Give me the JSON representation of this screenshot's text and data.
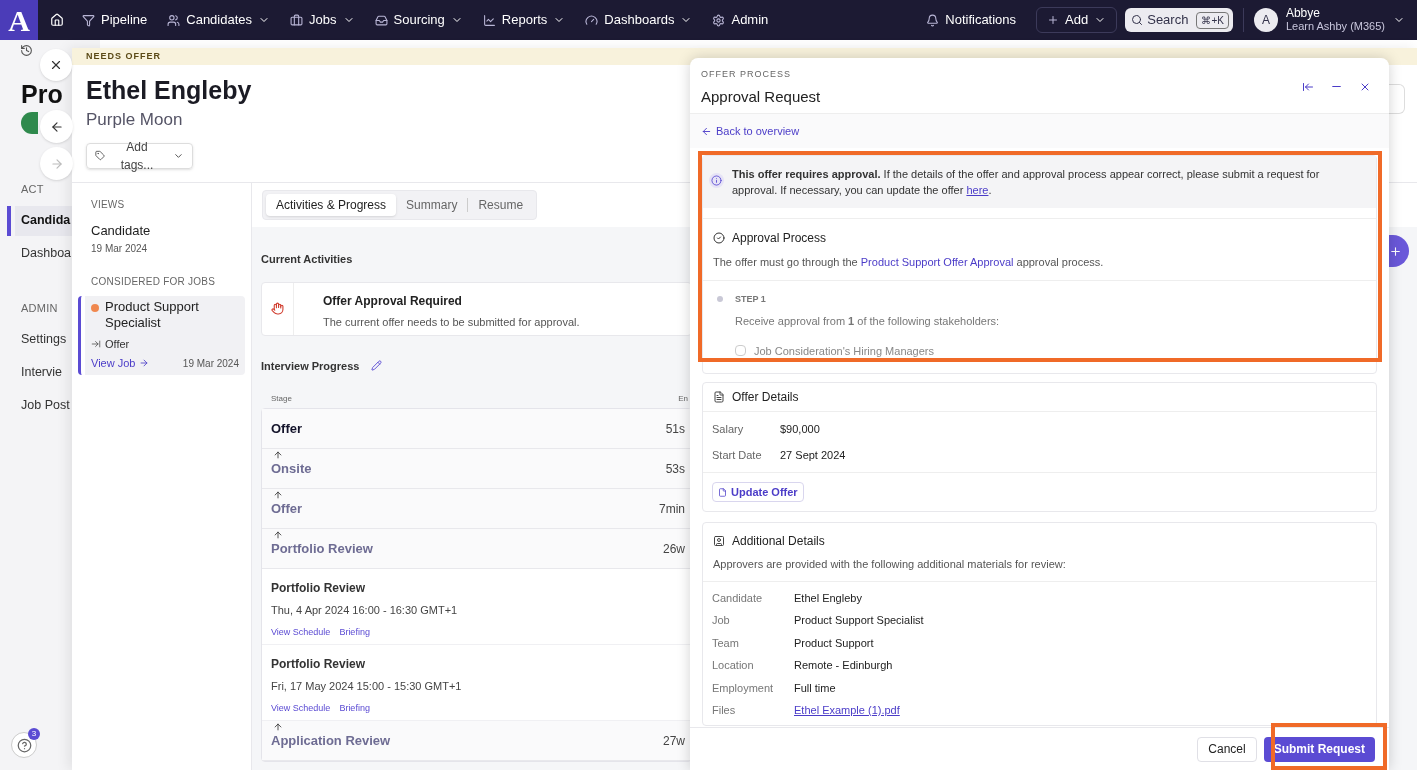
{
  "nav": {
    "logo": "A",
    "items": [
      {
        "label": "Pipeline",
        "dropdown": false
      },
      {
        "label": "Candidates",
        "dropdown": true
      },
      {
        "label": "Jobs",
        "dropdown": true
      },
      {
        "label": "Sourcing",
        "dropdown": true
      },
      {
        "label": "Reports",
        "dropdown": true
      },
      {
        "label": "Dashboards",
        "dropdown": true
      },
      {
        "label": "Admin",
        "dropdown": false
      }
    ],
    "notifications": "Notifications",
    "add": "Add",
    "search": {
      "label": "Search",
      "shortcut": "⌘+K"
    },
    "user": {
      "initial": "A",
      "name": "Abbye",
      "org": "Learn Ashby (M365)"
    }
  },
  "background": {
    "title": "Pro",
    "sections": [
      {
        "heading": "ACT",
        "items": [
          {
            "label": "Candida",
            "selected": true
          },
          {
            "label": "Dashboa",
            "selected": false
          }
        ]
      },
      {
        "heading": "ADMIN",
        "items": [
          {
            "label": "Settings",
            "selected": false
          },
          {
            "label": "Intervie",
            "selected": false
          },
          {
            "label": "Job Post",
            "selected": false
          }
        ]
      }
    ],
    "help_badge": "3"
  },
  "drawer": {
    "banner": "NEEDS OFFER",
    "name": "Ethel Engleby",
    "company": "Purple Moon",
    "tags_button": "Add tags...",
    "views": {
      "heading": "VIEWS",
      "items": [
        {
          "label": "Candidate",
          "date": "19 Mar 2024"
        }
      ]
    },
    "jobs": {
      "heading": "CONSIDERED FOR JOBS",
      "items": [
        {
          "title": "Product Support Specialist",
          "color": "#f0884f",
          "stage": "Offer",
          "link": "View Job",
          "date": "19 Mar 2024",
          "selected": true
        }
      ]
    },
    "tabs": [
      {
        "label": "Activities & Progress",
        "selected": true
      },
      {
        "label": "Summary",
        "selected": false
      },
      {
        "label": "Resume",
        "selected": false
      }
    ],
    "current_activities": {
      "heading": "Current Activities",
      "items": [
        {
          "title": "Offer Approval Required",
          "description": "The current offer needs to be submitted for approval."
        }
      ]
    },
    "interview_progress": {
      "heading": "Interview Progress",
      "columns": [
        "Stage",
        "En"
      ],
      "rows": [
        {
          "kind": "stage",
          "stage": "Offer",
          "current": true,
          "time": "51s"
        },
        {
          "kind": "stage",
          "stage": "Onsite",
          "current": false,
          "time": "53s"
        },
        {
          "kind": "stage",
          "stage": "Offer",
          "current": false,
          "time": "7min"
        },
        {
          "kind": "stage",
          "stage": "Portfolio Review",
          "current": false,
          "time": "26w"
        },
        {
          "kind": "interview",
          "title": "Portfolio Review",
          "when": "Thu, 4 Apr 2024 16:00 - 16:30 GMT+1",
          "links": [
            "View Schedule",
            "Briefing"
          ]
        },
        {
          "kind": "interview",
          "title": "Portfolio Review",
          "when": "Fri, 17 May 2024 15:00 - 15:30 GMT+1",
          "links": [
            "View Schedule",
            "Briefing"
          ]
        },
        {
          "kind": "stage",
          "stage": "Application Review",
          "current": false,
          "time": "27w"
        }
      ]
    }
  },
  "modal": {
    "eyebrow": "OFFER PROCESS",
    "title": "Approval Request",
    "back": "Back to overview",
    "notice": "**This offer requires approval.** If the details of the offer and approval process appear correct, please submit a request for approval. If necessary, you can update the offer",
    "notice_link": "here",
    "notice_end": ".",
    "approval": {
      "title": "Approval Process",
      "text_before": "The offer must go through the",
      "link": "Product Support Offer Approval",
      "text_after": "approval process.",
      "steps": [
        {
          "label": "STEP 1",
          "description": "Receive approval from **1** of the following stakeholders:",
          "approvers": [
            {
              "label": "Job Consideration's Hiring Managers",
              "checked": false
            }
          ]
        }
      ]
    },
    "offer_details": {
      "title": "Offer Details",
      "fields": [
        {
          "label": "Salary",
          "value": "$90,000"
        },
        {
          "label": "Start Date",
          "value": "27 Sept 2024"
        }
      ],
      "button": "Update Offer"
    },
    "additional": {
      "title": "Additional Details",
      "description": "Approvers are provided with the following additional materials for review:",
      "fields": [
        {
          "kind": "text",
          "label": "Candidate",
          "value": "Ethel Engleby"
        },
        {
          "kind": "text",
          "label": "Job",
          "value": "Product Support Specialist"
        },
        {
          "kind": "text",
          "label": "Team",
          "value": "Product Support"
        },
        {
          "kind": "text",
          "label": "Location",
          "value": "Remote - Edinburgh"
        },
        {
          "kind": "text",
          "label": "Employment",
          "value": "Full time"
        },
        {
          "kind": "link",
          "label": "Files",
          "value": "Ethel Example (1).pdf"
        }
      ]
    },
    "footer": {
      "cancel": "Cancel",
      "submit": "Submit Request"
    }
  }
}
